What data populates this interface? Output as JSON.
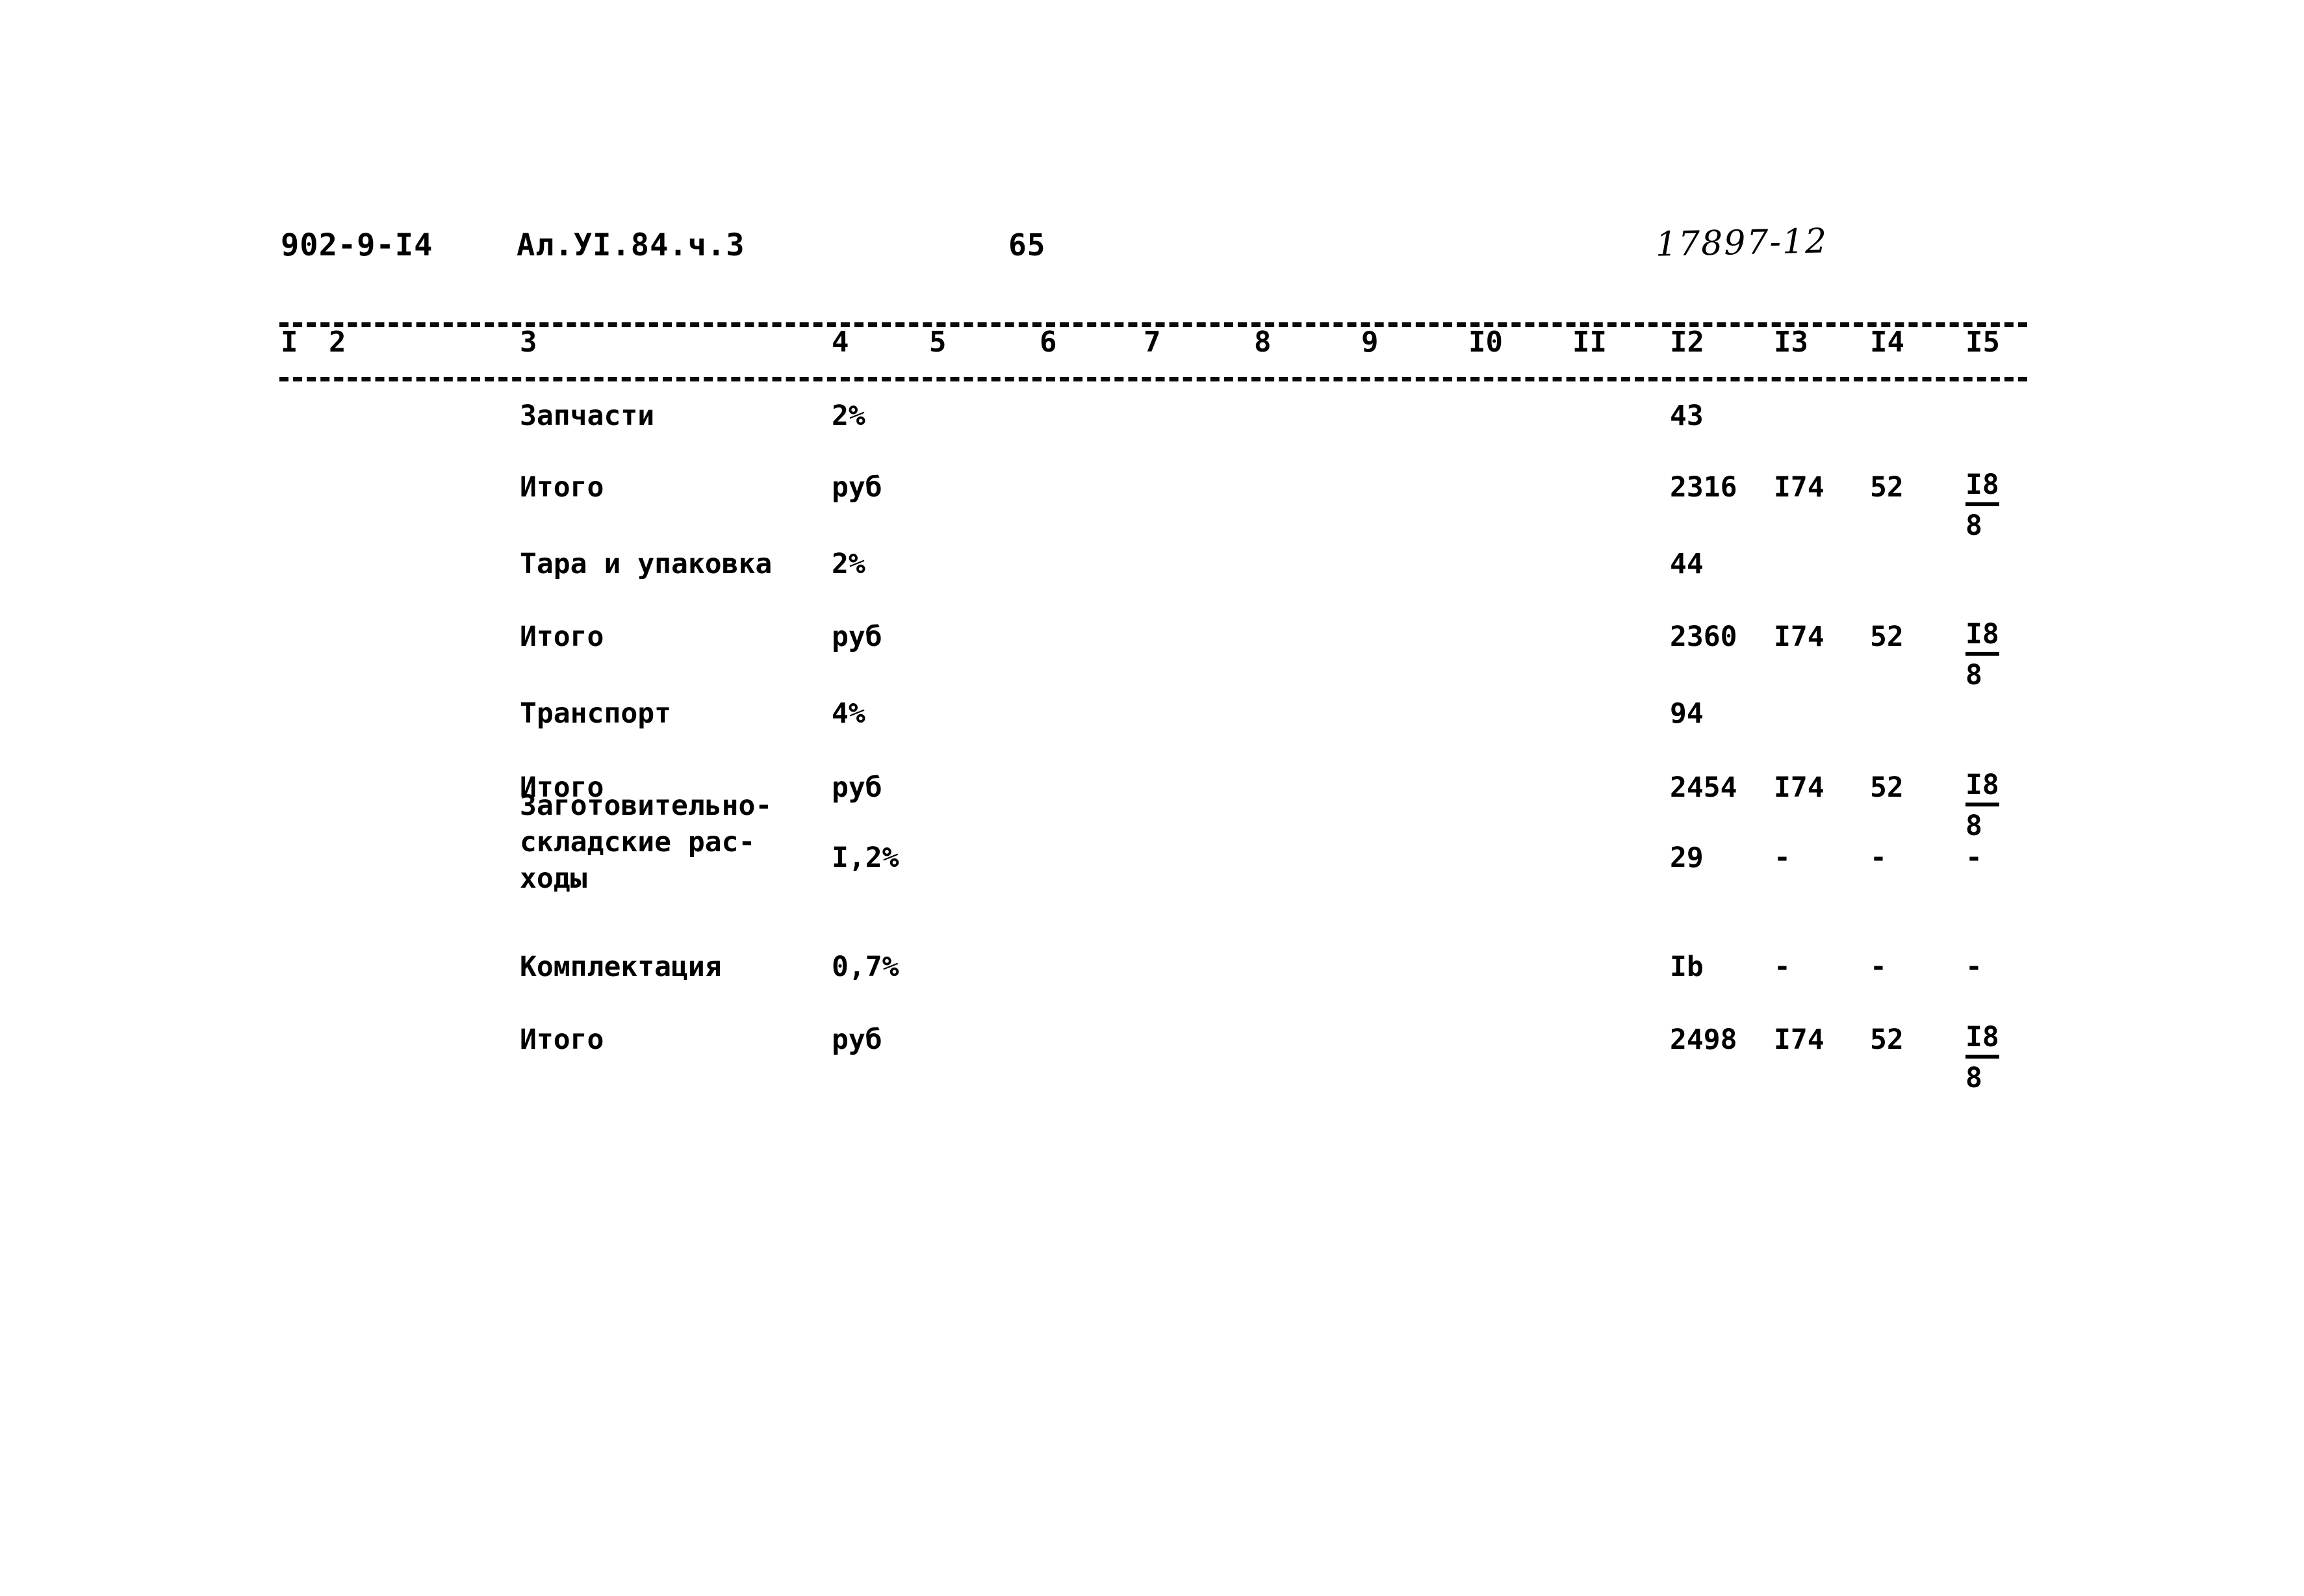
{
  "header": {
    "doc_code": "902-9-I4",
    "album": "Ал.УI.84.ч.3",
    "page_number": "65",
    "stamp": "17897-12"
  },
  "table": {
    "column_numbers": [
      "I",
      "2",
      "3",
      "4",
      "5",
      "6",
      "7",
      "8",
      "9",
      "I0",
      "II",
      "I2",
      "I3",
      "I4",
      "I5"
    ],
    "rows": [
      {
        "name": "Запчасти",
        "unit": "2%",
        "c12": "43",
        "c13": "",
        "c14": "",
        "c15_top": "",
        "c15_bot": ""
      },
      {
        "name": "Итого",
        "unit": "руб",
        "c12": "2316",
        "c13": "I74",
        "c14": "52",
        "c15_top": "I8",
        "c15_bot": "8"
      },
      {
        "name": "Тара и упаковка",
        "unit": "2%",
        "c12": "44",
        "c13": "",
        "c14": "",
        "c15_top": "",
        "c15_bot": ""
      },
      {
        "name": "Итого",
        "unit": "руб",
        "c12": "2360",
        "c13": "I74",
        "c14": "52",
        "c15_top": "I8",
        "c15_bot": "8"
      },
      {
        "name": "Транспорт",
        "unit": "4%",
        "c12": "94",
        "c13": "",
        "c14": "",
        "c15_top": "",
        "c15_bot": ""
      },
      {
        "name": "Итого",
        "unit": "руб",
        "c12": "2454",
        "c13": "I74",
        "c14": "52",
        "c15_top": "I8",
        "c15_bot": "8"
      },
      {
        "name_line1": "Заготовительно-",
        "name_line2": "складские рас-",
        "name_line3": "ходы",
        "unit": "I,2%",
        "c12": "29",
        "c13": "-",
        "c14": "-",
        "c15_top": "-",
        "c15_bot": ""
      },
      {
        "name": "Комплектация",
        "unit": "0,7%",
        "c12": "Ib",
        "c13": "-",
        "c14": "-",
        "c15_top": "-",
        "c15_bot": ""
      },
      {
        "name": "Итого",
        "unit": "руб",
        "c12": "2498",
        "c13": "I74",
        "c14": "52",
        "c15_top": "I8",
        "c15_bot": "8"
      }
    ]
  }
}
